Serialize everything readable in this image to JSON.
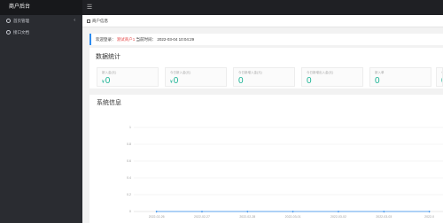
{
  "app": {
    "brand": "商户后台"
  },
  "sidebar": {
    "items": [
      {
        "label": "首页管理",
        "icon": "home-icon",
        "arrow": "‹"
      },
      {
        "label": "接口文档",
        "icon": "doc-icon"
      }
    ]
  },
  "tabs": [
    {
      "label": "商户信息"
    }
  ],
  "welcome": {
    "prefix": "欢迎登录：",
    "name": "测试商户1",
    "time_label": "当前时间：",
    "time": "2022-03-04 10:04:29"
  },
  "stats": {
    "title": "数据统计",
    "cards": [
      {
        "label": "新入金(元)",
        "symbol": "¥",
        "value": "0"
      },
      {
        "label": "今日新入金(元)",
        "symbol": "¥",
        "value": "0"
      },
      {
        "label": "今日新增入金(元)",
        "symbol": "",
        "value": "0"
      },
      {
        "label": "今日新增出入金(元)",
        "symbol": "",
        "value": "0"
      },
      {
        "label": "新入单",
        "symbol": "",
        "value": "0"
      },
      {
        "label": "今",
        "symbol": "",
        "value": "0"
      }
    ]
  },
  "chart_data": {
    "type": "line",
    "title": "系统信息",
    "categories": [
      "2022-02-26",
      "2022-02-27",
      "2022-02-28",
      "2022-03-01",
      "2022-03-02",
      "2022-03-03",
      "2022-0"
    ],
    "yticks": [
      "0",
      "0.2",
      "0.4",
      "0.6",
      "0.8",
      "1"
    ],
    "ylim": [
      0,
      1
    ],
    "series": [
      {
        "values": [
          0,
          0,
          0,
          0,
          0,
          0,
          0
        ]
      }
    ],
    "colors": {
      "line": "#2d8cf0",
      "grid": "#ececec",
      "axis": "#d0d0d0"
    }
  }
}
